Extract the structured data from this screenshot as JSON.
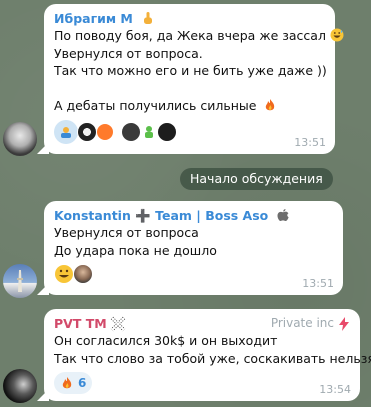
{
  "messages": [
    {
      "sender": "Ибрагим М",
      "sender_color": "#3a8ad6",
      "sender_badge": "pointing-up-emoji",
      "lines": [
        "По поводу боя, да Жека вчера же зассал",
        "Увернулся от вопроса.",
        "Так что можно его и не бить уже даже ))",
        "",
        "А дебаты получились сильные"
      ],
      "line_emojis": [
        "grin-sweat-emoji",
        "",
        "",
        "",
        "fire-emoji"
      ],
      "reaction_avatars": [
        "avatar-1",
        "avatar-2",
        "avatar-3",
        "avatar-4",
        "avatar-5",
        "avatar-6"
      ],
      "time": "13:51"
    },
    {
      "sender": "Konstantin ➕ Team | Boss Aso",
      "sender_color": "#3a8ad6",
      "sender_badge": "apple-icon",
      "lines": [
        "Увернулся от вопроса",
        "До удара пока не дошло"
      ],
      "reaction_avatars": [
        "avatar-grin",
        "avatar-face"
      ],
      "time": "13:51"
    },
    {
      "sender": "PVT TM",
      "sender_color": "#d24a6a",
      "sender_badge": "x-logo-icon",
      "admin_title": "Private inc",
      "lines": [
        "Он согласился 30k$ и он выходит",
        "Так что слово за тобой уже, соскакивать нельзя"
      ],
      "reaction": {
        "emoji": "fire-emoji",
        "count": "6"
      },
      "time": "13:54"
    }
  ],
  "service_message": "Начало обсуждения",
  "colors": {
    "bubble": "#ffffff",
    "accent": "#3a8ad6",
    "time": "#a0aab0",
    "service_bg": "#4a5d4f"
  }
}
